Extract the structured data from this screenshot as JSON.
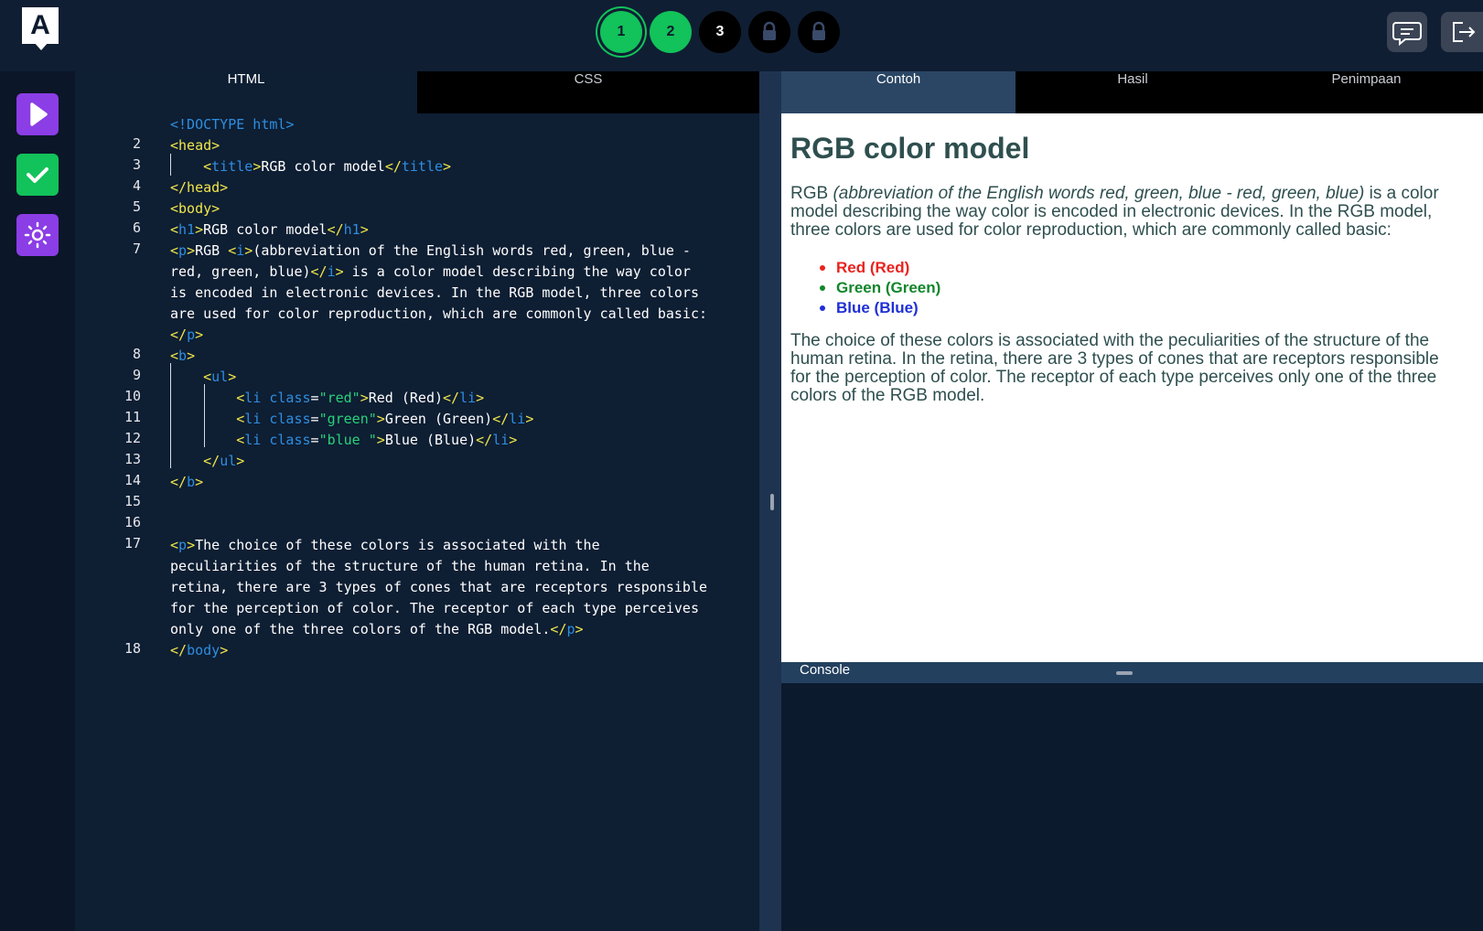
{
  "app": {
    "logo_letter": "A"
  },
  "steps": [
    {
      "label": "1",
      "state": "done-current"
    },
    {
      "label": "2",
      "state": "done"
    },
    {
      "label": "3",
      "state": "todo"
    },
    {
      "label": "",
      "state": "locked"
    },
    {
      "label": "",
      "state": "locked"
    }
  ],
  "topbar": {
    "chat_icon": "chat-bubble-icon",
    "exit_icon": "logout-icon"
  },
  "leftrail": {
    "run_icon": "play-icon",
    "check_icon": "check-icon",
    "theme_icon": "sun-icon"
  },
  "editor": {
    "tabs": [
      "HTML",
      "CSS"
    ],
    "active_tab": "HTML",
    "line_numbers": [
      "2",
      "3",
      "4",
      "5",
      "6",
      "7",
      "8",
      "9",
      "10",
      "11",
      "12",
      "13",
      "14",
      "15",
      "16",
      "17",
      "18"
    ],
    "lines": {
      "l1": "<!DOCTYPE html>",
      "l2": "<head>",
      "l3_text": "RGB color model",
      "l4": "</head>",
      "l5": "<body>",
      "l6_text": "RGB color model",
      "l7_a": "RGB ",
      "l7_b": "(abbreviation of the English words red, green, blue -",
      "l7_c": "red, green, blue)",
      "l7_d": " is a color model describing the way color",
      "l7_e": "is encoded in electronic devices. In the RGB model, three colors",
      "l7_f": "are used for color reproduction, which are commonly called basic:",
      "l11_red": "Red (Red)",
      "l11_green": "Green (Green)",
      "l11_blue": "Blue (Blue)",
      "cls_red": "\"red\"",
      "cls_green": "\"green\"",
      "cls_blue": "\"blue \"",
      "p2_a": "The choice of these colors is associated with the",
      "p2_b": "peculiarities of the structure of the human retina. In the",
      "p2_c": "retina, there are 3 types of cones that are receptors responsible",
      "p2_d": "for the perception of color. The receptor of each type perceives",
      "p2_e": "only one of the three colors of the RGB model."
    }
  },
  "right": {
    "tabs": [
      "Contoh",
      "Hasil",
      "Penimpaan"
    ],
    "active_tab": "Contoh",
    "preview": {
      "h1": "RGB color model",
      "p1_plain": "RGB ",
      "p1_italic": "(abbreviation of the English words red, green, blue - red, green, blue)",
      "p1_rest": " is a color model describing the way color is encoded in electronic devices. In the RGB model, three colors are used for color reproduction, which are commonly called basic:",
      "list": [
        {
          "text": "Red (Red)",
          "color": "#e8231e"
        },
        {
          "text": "Green (Green)",
          "color": "#12862b"
        },
        {
          "text": "Blue (Blue)",
          "color": "#1f2fd6"
        }
      ],
      "p2": "The choice of these colors is associated with the peculiarities of the structure of the human retina. In the retina, there are 3 types of cones that are receptors responsible for the perception of color. The receptor of each type perceives only one of the three colors of the RGB model."
    },
    "console_label": "Console"
  },
  "colors": {
    "accent_green": "#12c25a",
    "accent_purple": "#8b3de6",
    "background": "#0c1a2e"
  }
}
